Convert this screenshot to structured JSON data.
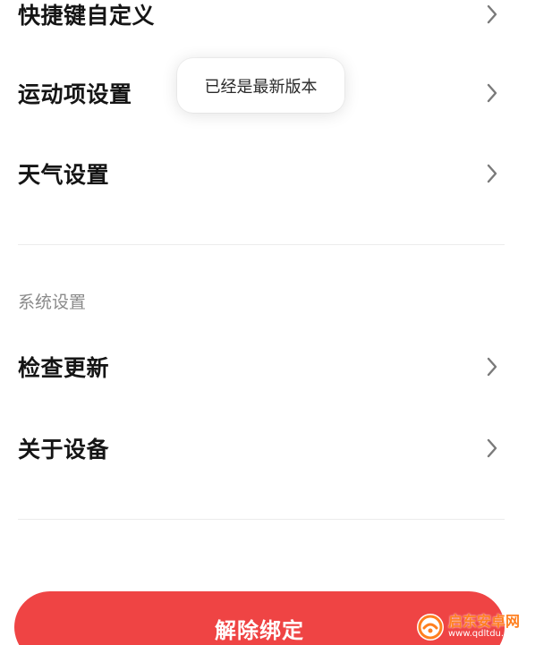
{
  "settings_items": [
    {
      "label": "快捷键自定义"
    },
    {
      "label": "运动项设置"
    },
    {
      "label": "天气设置"
    }
  ],
  "system_section": {
    "title": "系统设置",
    "items": [
      {
        "label": "检查更新"
      },
      {
        "label": "关于设备"
      }
    ]
  },
  "toast": {
    "message": "已经是最新版本"
  },
  "unbind_button": {
    "label": "解除绑定"
  },
  "watermark": {
    "title": "启东安卓网",
    "url": "www.qdltdu.com"
  },
  "colors": {
    "accent": "#ef4444",
    "text_primary": "#151515",
    "text_secondary": "#8a8a8a",
    "divider": "#ececec",
    "chevron": "#7a7a7a",
    "watermark_orange": "#ff7f1f"
  },
  "icons": {
    "row_chevron": "chevron-right-icon",
    "watermark_logo": "qdltdu-logo-icon"
  }
}
